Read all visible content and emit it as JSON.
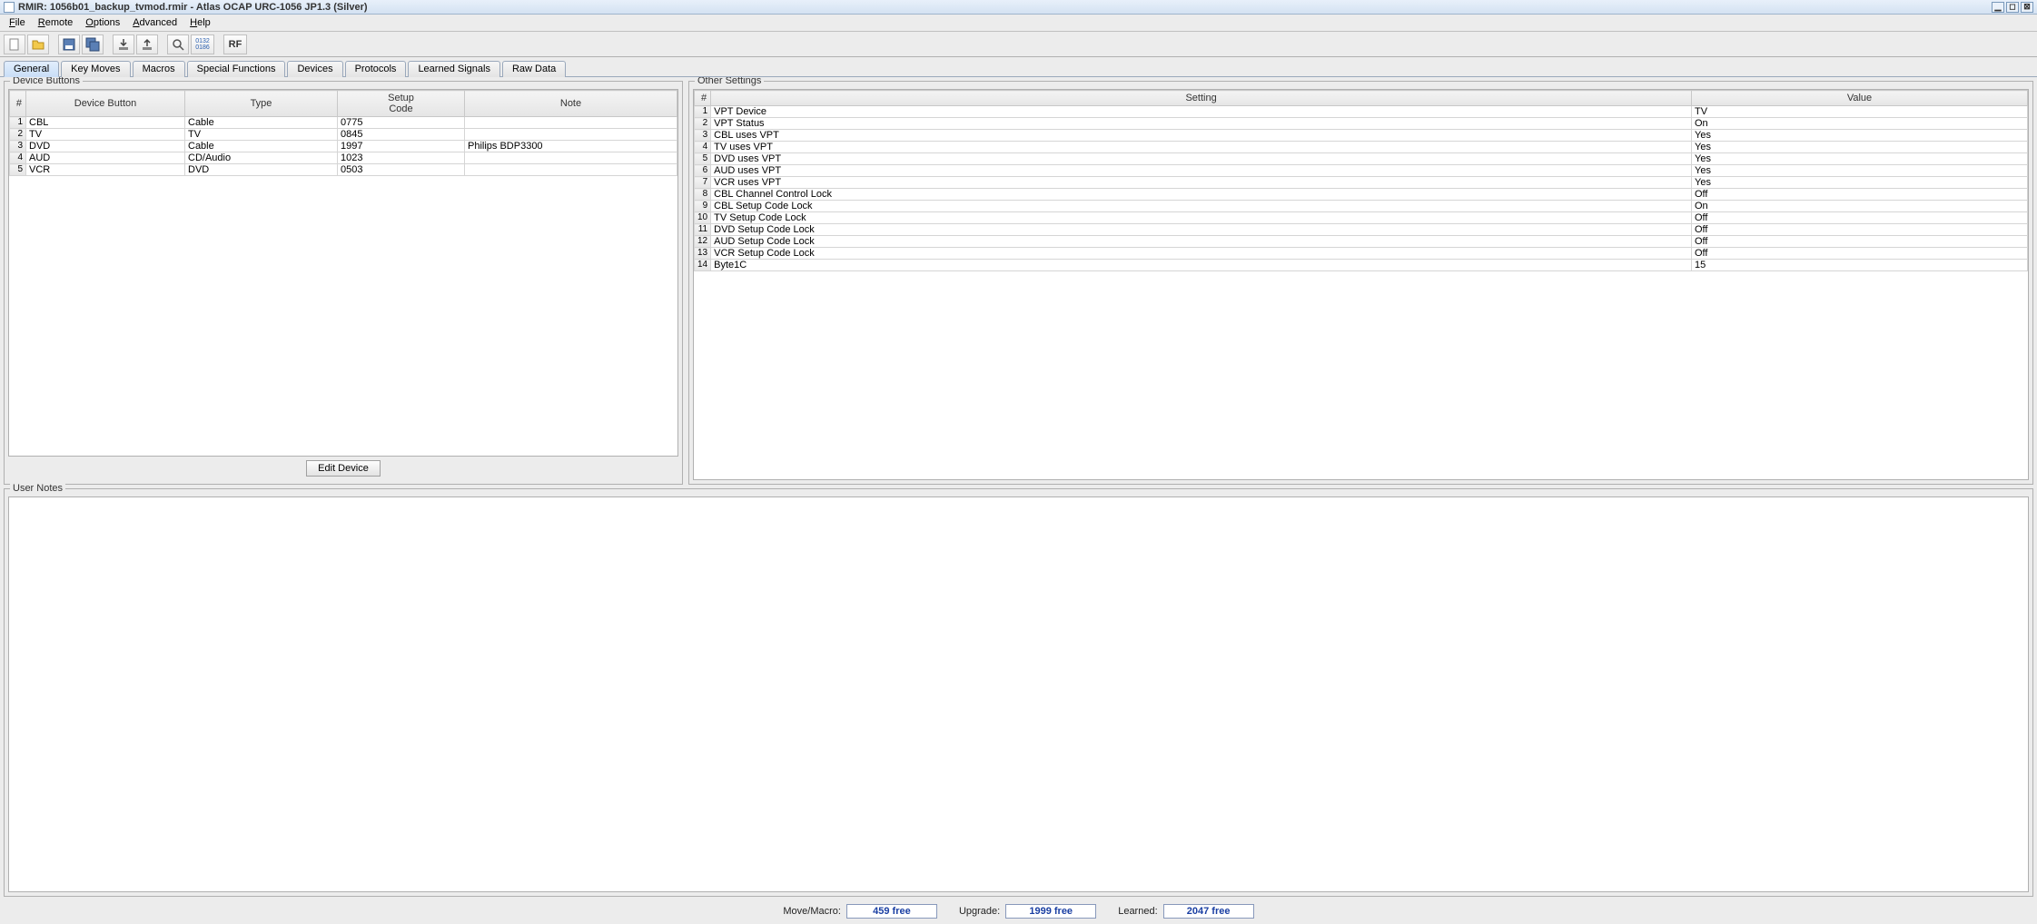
{
  "title": "RMIR: 1056b01_backup_tvmod.rmir - Atlas OCAP URC-1056 JP1.3 (Silver)",
  "menu": [
    "File",
    "Remote",
    "Options",
    "Advanced",
    "Help"
  ],
  "tabs": [
    "General",
    "Key Moves",
    "Macros",
    "Special Functions",
    "Devices",
    "Protocols",
    "Learned Signals",
    "Raw Data"
  ],
  "active_tab": 0,
  "panels": {
    "device": "Device Buttons",
    "other": "Other Settings",
    "notes": "User Notes"
  },
  "device_columns": [
    "#",
    "Device Button",
    "Type",
    "Setup\nCode",
    "Note"
  ],
  "device_rows": [
    {
      "n": "1",
      "btn": "CBL",
      "type": "Cable",
      "code": "0775",
      "note": ""
    },
    {
      "n": "2",
      "btn": "TV",
      "type": "TV",
      "code": "0845",
      "note": ""
    },
    {
      "n": "3",
      "btn": "DVD",
      "type": "Cable",
      "code": "1997",
      "note": "Philips BDP3300"
    },
    {
      "n": "4",
      "btn": "AUD",
      "type": "CD/Audio",
      "code": "1023",
      "note": ""
    },
    {
      "n": "5",
      "btn": "VCR",
      "type": "DVD",
      "code": "0503",
      "note": ""
    }
  ],
  "edit_button": "Edit Device",
  "settings_columns": [
    "#",
    "Setting",
    "Value"
  ],
  "settings_rows": [
    {
      "n": "1",
      "s": "VPT Device",
      "v": "TV"
    },
    {
      "n": "2",
      "s": "VPT Status",
      "v": "On"
    },
    {
      "n": "3",
      "s": "CBL uses VPT",
      "v": "Yes"
    },
    {
      "n": "4",
      "s": "TV  uses VPT",
      "v": "Yes"
    },
    {
      "n": "5",
      "s": "DVD uses VPT",
      "v": "Yes"
    },
    {
      "n": "6",
      "s": "AUD uses VPT",
      "v": "Yes"
    },
    {
      "n": "7",
      "s": "VCR uses VPT",
      "v": "Yes"
    },
    {
      "n": "8",
      "s": "CBL Channel Control Lock",
      "v": "Off"
    },
    {
      "n": "9",
      "s": "CBL Setup Code Lock",
      "v": "On"
    },
    {
      "n": "10",
      "s": "TV  Setup Code Lock",
      "v": "Off"
    },
    {
      "n": "11",
      "s": "DVD Setup Code Lock",
      "v": "Off"
    },
    {
      "n": "12",
      "s": "AUD Setup Code Lock",
      "v": "Off"
    },
    {
      "n": "13",
      "s": "VCR Setup Code Lock",
      "v": "Off"
    },
    {
      "n": "14",
      "s": "Byte1C",
      "v": "15"
    }
  ],
  "status": {
    "move_label": "Move/Macro:",
    "move_val": "459 free",
    "upgrade_label": "Upgrade:",
    "upgrade_val": "1999 free",
    "learned_label": "Learned:",
    "learned_val": "2047 free"
  }
}
